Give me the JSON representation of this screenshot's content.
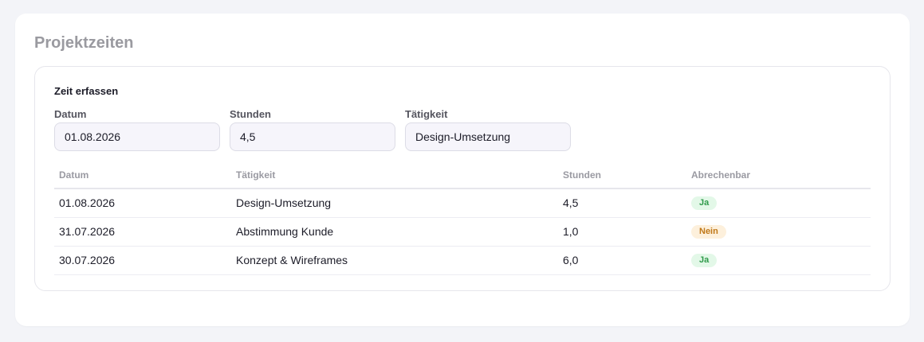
{
  "page": {
    "title": "Projektzeiten"
  },
  "form": {
    "heading": "Zeit erfassen",
    "fields": [
      {
        "label": "Datum",
        "value": "01.08.2026"
      },
      {
        "label": "Stunden",
        "value": "4,5"
      },
      {
        "label": "Tätigkeit",
        "value": "Design-Umsetzung"
      }
    ]
  },
  "table": {
    "columns": [
      "Datum",
      "Tätigkeit",
      "Stunden",
      "Abrechenbar"
    ],
    "rows": [
      {
        "date": "01.08.2026",
        "task": "Design-Umsetzung",
        "hours": "4,5",
        "billable": "Ja",
        "billable_status": "yes"
      },
      {
        "date": "31.07.2026",
        "task": "Abstimmung Kunde",
        "hours": "1,0",
        "billable": "Nein",
        "billable_status": "no"
      },
      {
        "date": "30.07.2026",
        "task": "Konzept & Wireframes",
        "hours": "6,0",
        "billable": "Ja",
        "billable_status": "yes"
      }
    ]
  },
  "colors": {
    "page_background": "#f3f4f8",
    "badge_yes_bg": "#e3f8e8",
    "badge_yes_text": "#2f9a4a",
    "badge_no_bg": "#fdf0dc",
    "badge_no_text": "#c07818"
  }
}
